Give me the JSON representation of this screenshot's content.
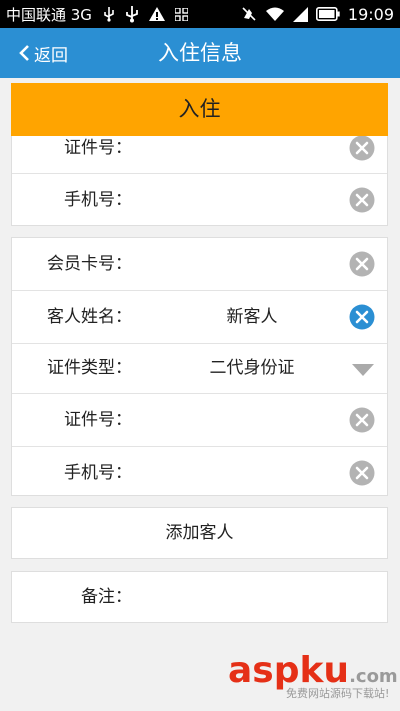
{
  "status_bar": {
    "carrier": "中国联通 3G",
    "time": "19:09",
    "icons": [
      "usb-icon",
      "usb-alt-icon",
      "warning-icon",
      "grid-icon",
      "mute-icon",
      "wifi-icon",
      "signal-icon",
      "battery-icon"
    ]
  },
  "nav": {
    "back_label": "返回",
    "title": "入住信息"
  },
  "checkin_button": "入住",
  "guest_card_1": {
    "rows": [
      {
        "label": "证件号：",
        "value": ""
      },
      {
        "label": "手机号：",
        "value": ""
      }
    ]
  },
  "guest_card_2": {
    "rows": [
      {
        "label": "会员卡号：",
        "value": ""
      },
      {
        "label": "客人姓名：",
        "value": "新客人"
      },
      {
        "label": "证件类型：",
        "value": "二代身份证"
      },
      {
        "label": "证件号：",
        "value": ""
      },
      {
        "label": "手机号：",
        "value": ""
      }
    ]
  },
  "add_guest_label": "添加客人",
  "remarks": {
    "label": "备注：",
    "value": ""
  },
  "watermark": {
    "logo": "aspku",
    "suffix": ".com",
    "tagline": "免费网站源码下载站!"
  },
  "colors": {
    "nav_bg": "#2b8fd3",
    "checkin_bg": "#ffa400",
    "clear_active": "#2b8fd3",
    "clear_inactive": "#b3b3b3"
  }
}
